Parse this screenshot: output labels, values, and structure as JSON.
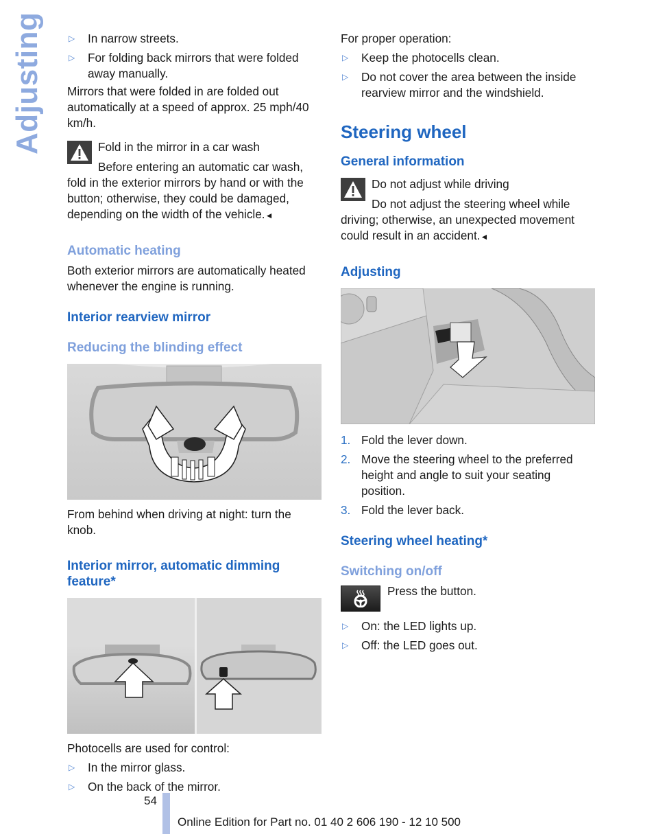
{
  "side_title": "Adjusting",
  "left": {
    "bullets_top": [
      "In narrow streets.",
      "For folding back mirrors that were folded away manually."
    ],
    "fold_out_text": "Mirrors that were folded in are folded out automatically at a speed of approx. 25 mph/40 km/h.",
    "warning1": {
      "title": "Fold in the mirror in a car wash",
      "body": "Before entering an automatic car wash, fold in the exterior mirrors by hand or with the button; otherwise, they could be damaged, depending on the width of the vehicle.",
      "end_mark": "◄"
    },
    "auto_heating": {
      "heading": "Automatic heating",
      "text": "Both exterior mirrors are automatically heated whenever the engine is running."
    },
    "interior_mirror_heading": "Interior rearview mirror",
    "reducing_heading": "Reducing the blinding effect",
    "figure1_caption": "From behind when driving at night: turn the knob.",
    "dimming_heading": "Interior mirror, automatic dimming feature*",
    "photocells_text": "Photocells are used for control:",
    "photocells_bullets": [
      "In the mirror glass.",
      "On the back of the mirror."
    ]
  },
  "right": {
    "proper_op_text": "For proper operation:",
    "proper_op_bullets": [
      "Keep the photocells clean.",
      "Do not cover the area between the inside rearview mirror and the windshield."
    ],
    "section_title": "Steering wheel",
    "general_info_heading": "General information",
    "warning2": {
      "title": "Do not adjust while driving",
      "body": "Do not adjust the steering wheel while driving; otherwise, an unexpected movement could result in an accident.",
      "end_mark": "◄"
    },
    "adjusting_heading": "Adjusting",
    "steps": [
      {
        "num": "1.",
        "text": "Fold the lever down."
      },
      {
        "num": "2.",
        "text": "Move the steering wheel to the preferred height and angle to suit your seating position."
      },
      {
        "num": "3.",
        "text": "Fold the lever back."
      }
    ],
    "heating_heading": "Steering wheel heating*",
    "switching_heading": "Switching on/off",
    "press_text": "Press the button.",
    "led_bullets": [
      "On: the LED lights up.",
      "Off: the LED goes out."
    ]
  },
  "icons": {
    "bullet": "triangle-right-icon",
    "warning": "warning-triangle-icon",
    "heated_wheel": "heated-steering-wheel-icon"
  },
  "colors": {
    "heading_blue": "#1f66c0",
    "subheading_light_blue": "#7fa0dc",
    "side_title": "#8eaadf",
    "footer_bar": "#b1c1e6"
  },
  "footer": {
    "page_number": "54",
    "edition_text": "Online Edition for Part no. 01 40 2 606 190 - 12 10 500"
  }
}
